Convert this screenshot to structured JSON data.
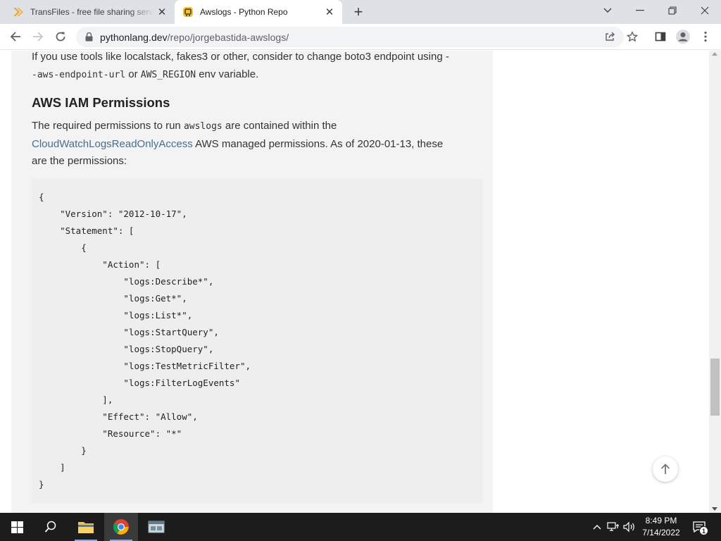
{
  "browser": {
    "tabs": [
      {
        "title": "TransFiles - free file sharing service",
        "active": false,
        "favicon": "chevrons-right-icon"
      },
      {
        "title": "Awslogs - Python Repo",
        "active": true,
        "favicon": "python-repo-icon"
      }
    ],
    "url_host": "pythonlang.dev",
    "url_path": "/repo/jorgebastida-awslogs/"
  },
  "page": {
    "intro_part1": "If you use tools like localstack, fakes3 or other, consider to change boto3 endpoint using -",
    "intro_code1": "-aws-endpoint-url",
    "intro_part2": " or ",
    "intro_code2": "AWS_REGION",
    "intro_part3": " env variable.",
    "heading": "AWS IAM Permissions",
    "perm_part1": "The required permissions to run ",
    "perm_code": "awslogs",
    "perm_part2": " are contained within the",
    "perm_link": "CloudWatchLogsReadOnlyAccess",
    "perm_part3": " AWS managed permissions. As of 2020-01-13, these",
    "perm_part4": "are the permissions:",
    "code_lines": [
      "{",
      "    \"Version\": \"2012-10-17\",",
      "    \"Statement\": [",
      "        {",
      "            \"Action\": [",
      "                \"logs:Describe*\",",
      "                \"logs:Get*\",",
      "                \"logs:List*\",",
      "                \"logs:StartQuery\",",
      "                \"logs:StopQuery\",",
      "                \"logs:TestMetricFilter\",",
      "                \"logs:FilterLogEvents\"",
      "            ],",
      "            \"Effect\": \"Allow\",",
      "            \"Resource\": \"*\"",
      "        }",
      "    ]",
      "}"
    ]
  },
  "taskbar": {
    "time": "8:49 PM",
    "date": "7/14/2022",
    "notification_count": "1"
  },
  "colors": {
    "link": "#4a6d8c",
    "article_bg": "#f3f3f3",
    "taskbar_bg": "#1c1c1c"
  }
}
